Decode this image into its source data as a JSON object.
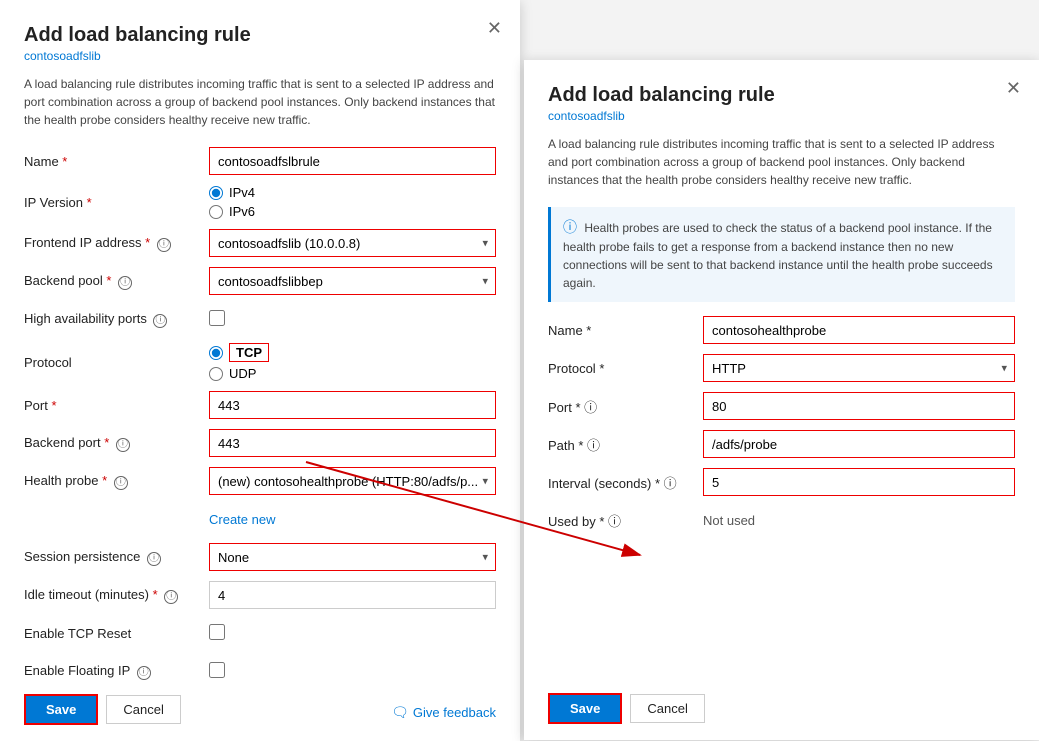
{
  "leftPanel": {
    "title": "Add load balancing rule",
    "subtitle": "contosoadfslib",
    "description": "A load balancing rule distributes incoming traffic that is sent to a selected IP address and port combination across a group of backend pool instances. Only backend instances that the health probe considers healthy receive new traffic.",
    "fields": {
      "name_label": "Name",
      "name_value": "contosoadfslbrule",
      "ip_version_label": "IP Version",
      "ip_version_options": [
        "IPv4",
        "IPv6"
      ],
      "ip_version_selected": "IPv4",
      "frontend_ip_label": "Frontend IP address",
      "frontend_ip_value": "contosoadfslib (10.0.0.8)",
      "backend_pool_label": "Backend pool",
      "backend_pool_value": "contosoadfslibbep",
      "ha_ports_label": "High availability ports",
      "protocol_label": "Protocol",
      "protocol_options": [
        "TCP",
        "UDP"
      ],
      "protocol_selected": "TCP",
      "port_label": "Port",
      "port_value": "443",
      "backend_port_label": "Backend port",
      "backend_port_value": "443",
      "health_probe_label": "Health probe",
      "health_probe_value": "(new) contosohealthprobe (HTTP:80/adfs/p...",
      "create_new_label": "Create new",
      "session_persistence_label": "Session persistence",
      "session_persistence_value": "None",
      "idle_timeout_label": "Idle timeout (minutes)",
      "idle_timeout_value": "4",
      "enable_tcp_reset_label": "Enable TCP Reset",
      "enable_floating_ip_label": "Enable Floating IP",
      "save_label": "Save",
      "cancel_label": "Cancel",
      "feedback_label": "Give feedback"
    }
  },
  "rightPanel": {
    "title": "Add load balancing rule",
    "subtitle": "contosoadfslib",
    "description": "A load balancing rule distributes incoming traffic that is sent to a selected IP address and port combination across a group of backend pool instances. Only backend instances that the health probe considers healthy receive new traffic.",
    "info_box_text": "Health probes are used to check the status of a backend pool instance. If the health probe fails to get a response from a backend instance then no new connections will be sent to that backend instance until the health probe succeeds again.",
    "fields": {
      "name_label": "Name",
      "name_value": "contosohealthprobe",
      "protocol_label": "Protocol",
      "protocol_value": "HTTP",
      "port_label": "Port",
      "port_value": "80",
      "path_label": "Path",
      "path_value": "/adfs/probe",
      "interval_label": "Interval (seconds)",
      "interval_value": "5",
      "used_by_label": "Used by",
      "used_by_value": "Not used",
      "save_label": "Save",
      "cancel_label": "Cancel"
    }
  }
}
